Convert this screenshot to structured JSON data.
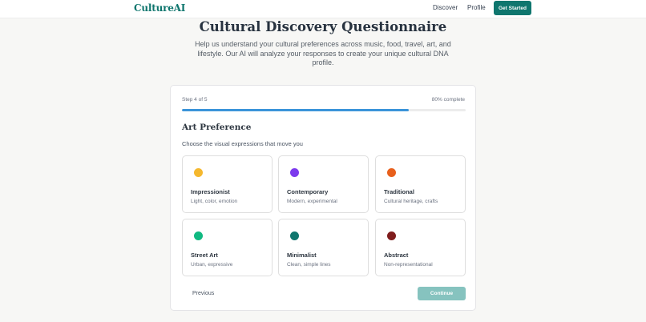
{
  "nav": {
    "brand": "CultureAI",
    "links": [
      "Discover",
      "Profile"
    ],
    "cta": "Get Started"
  },
  "header": {
    "title": "Cultural Discovery Questionnaire",
    "subtitle": "Help us understand your cultural preferences across music, food, travel, art, and lifestyle. Our AI will analyze your responses to create your unique cultural DNA profile."
  },
  "progress": {
    "step_label": "Step 4 of 5",
    "percent_label": "80% complete",
    "fraction": 0.8
  },
  "section": {
    "title": "Art Preference",
    "subtitle": "Choose the visual expressions that move you"
  },
  "options": [
    {
      "name": "Impressionist",
      "desc": "Light, color, emotion",
      "color": "#f5b82e"
    },
    {
      "name": "Contemporary",
      "desc": "Modern, experimental",
      "color": "#7c3aed"
    },
    {
      "name": "Traditional",
      "desc": "Cultural heritage, crafts",
      "color": "#e8601c"
    },
    {
      "name": "Street Art",
      "desc": "Urban, expressive",
      "color": "#10b981"
    },
    {
      "name": "Minimalist",
      "desc": "Clean, simple lines",
      "color": "#0f766e"
    },
    {
      "name": "Abstract",
      "desc": "Non-representational",
      "color": "#7f1d1d"
    }
  ],
  "actions": {
    "previous": "Previous",
    "continue": "Continue"
  }
}
